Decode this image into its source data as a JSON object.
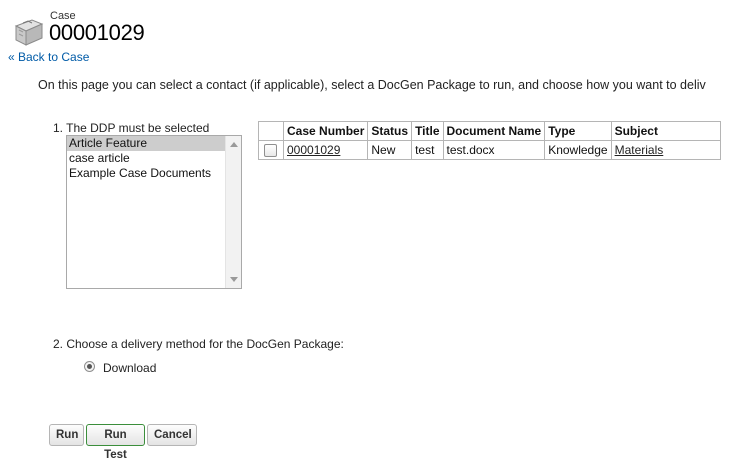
{
  "header": {
    "object_type": "Case",
    "record_number": "00001029",
    "back_link": "« Back to Case",
    "icon": "case-briefcase-icon"
  },
  "intro_text": "On this page you can select a contact (if applicable), select a DocGen Package to run, and choose how you want to deliv",
  "step1": {
    "label": "1. The DDP must be selected",
    "ddp_options": [
      "Article Feature",
      "case article",
      "Example Case Documents"
    ],
    "selected_option": "Article Feature"
  },
  "table": {
    "headers": [
      "Case Number",
      "Status",
      "Title",
      "Document Name",
      "Type",
      "Subject"
    ],
    "rows": [
      {
        "case_number": "00001029",
        "status": "New",
        "title": "test",
        "document_name": "test.docx",
        "type": "Knowledge",
        "subject": "Materials",
        "checked": false
      }
    ]
  },
  "step2": {
    "label": "2. Choose a delivery method for the DocGen Package:",
    "option": "Download",
    "selected": true
  },
  "buttons": {
    "run": "Run",
    "run_test": "Run Test",
    "cancel": "Cancel"
  }
}
